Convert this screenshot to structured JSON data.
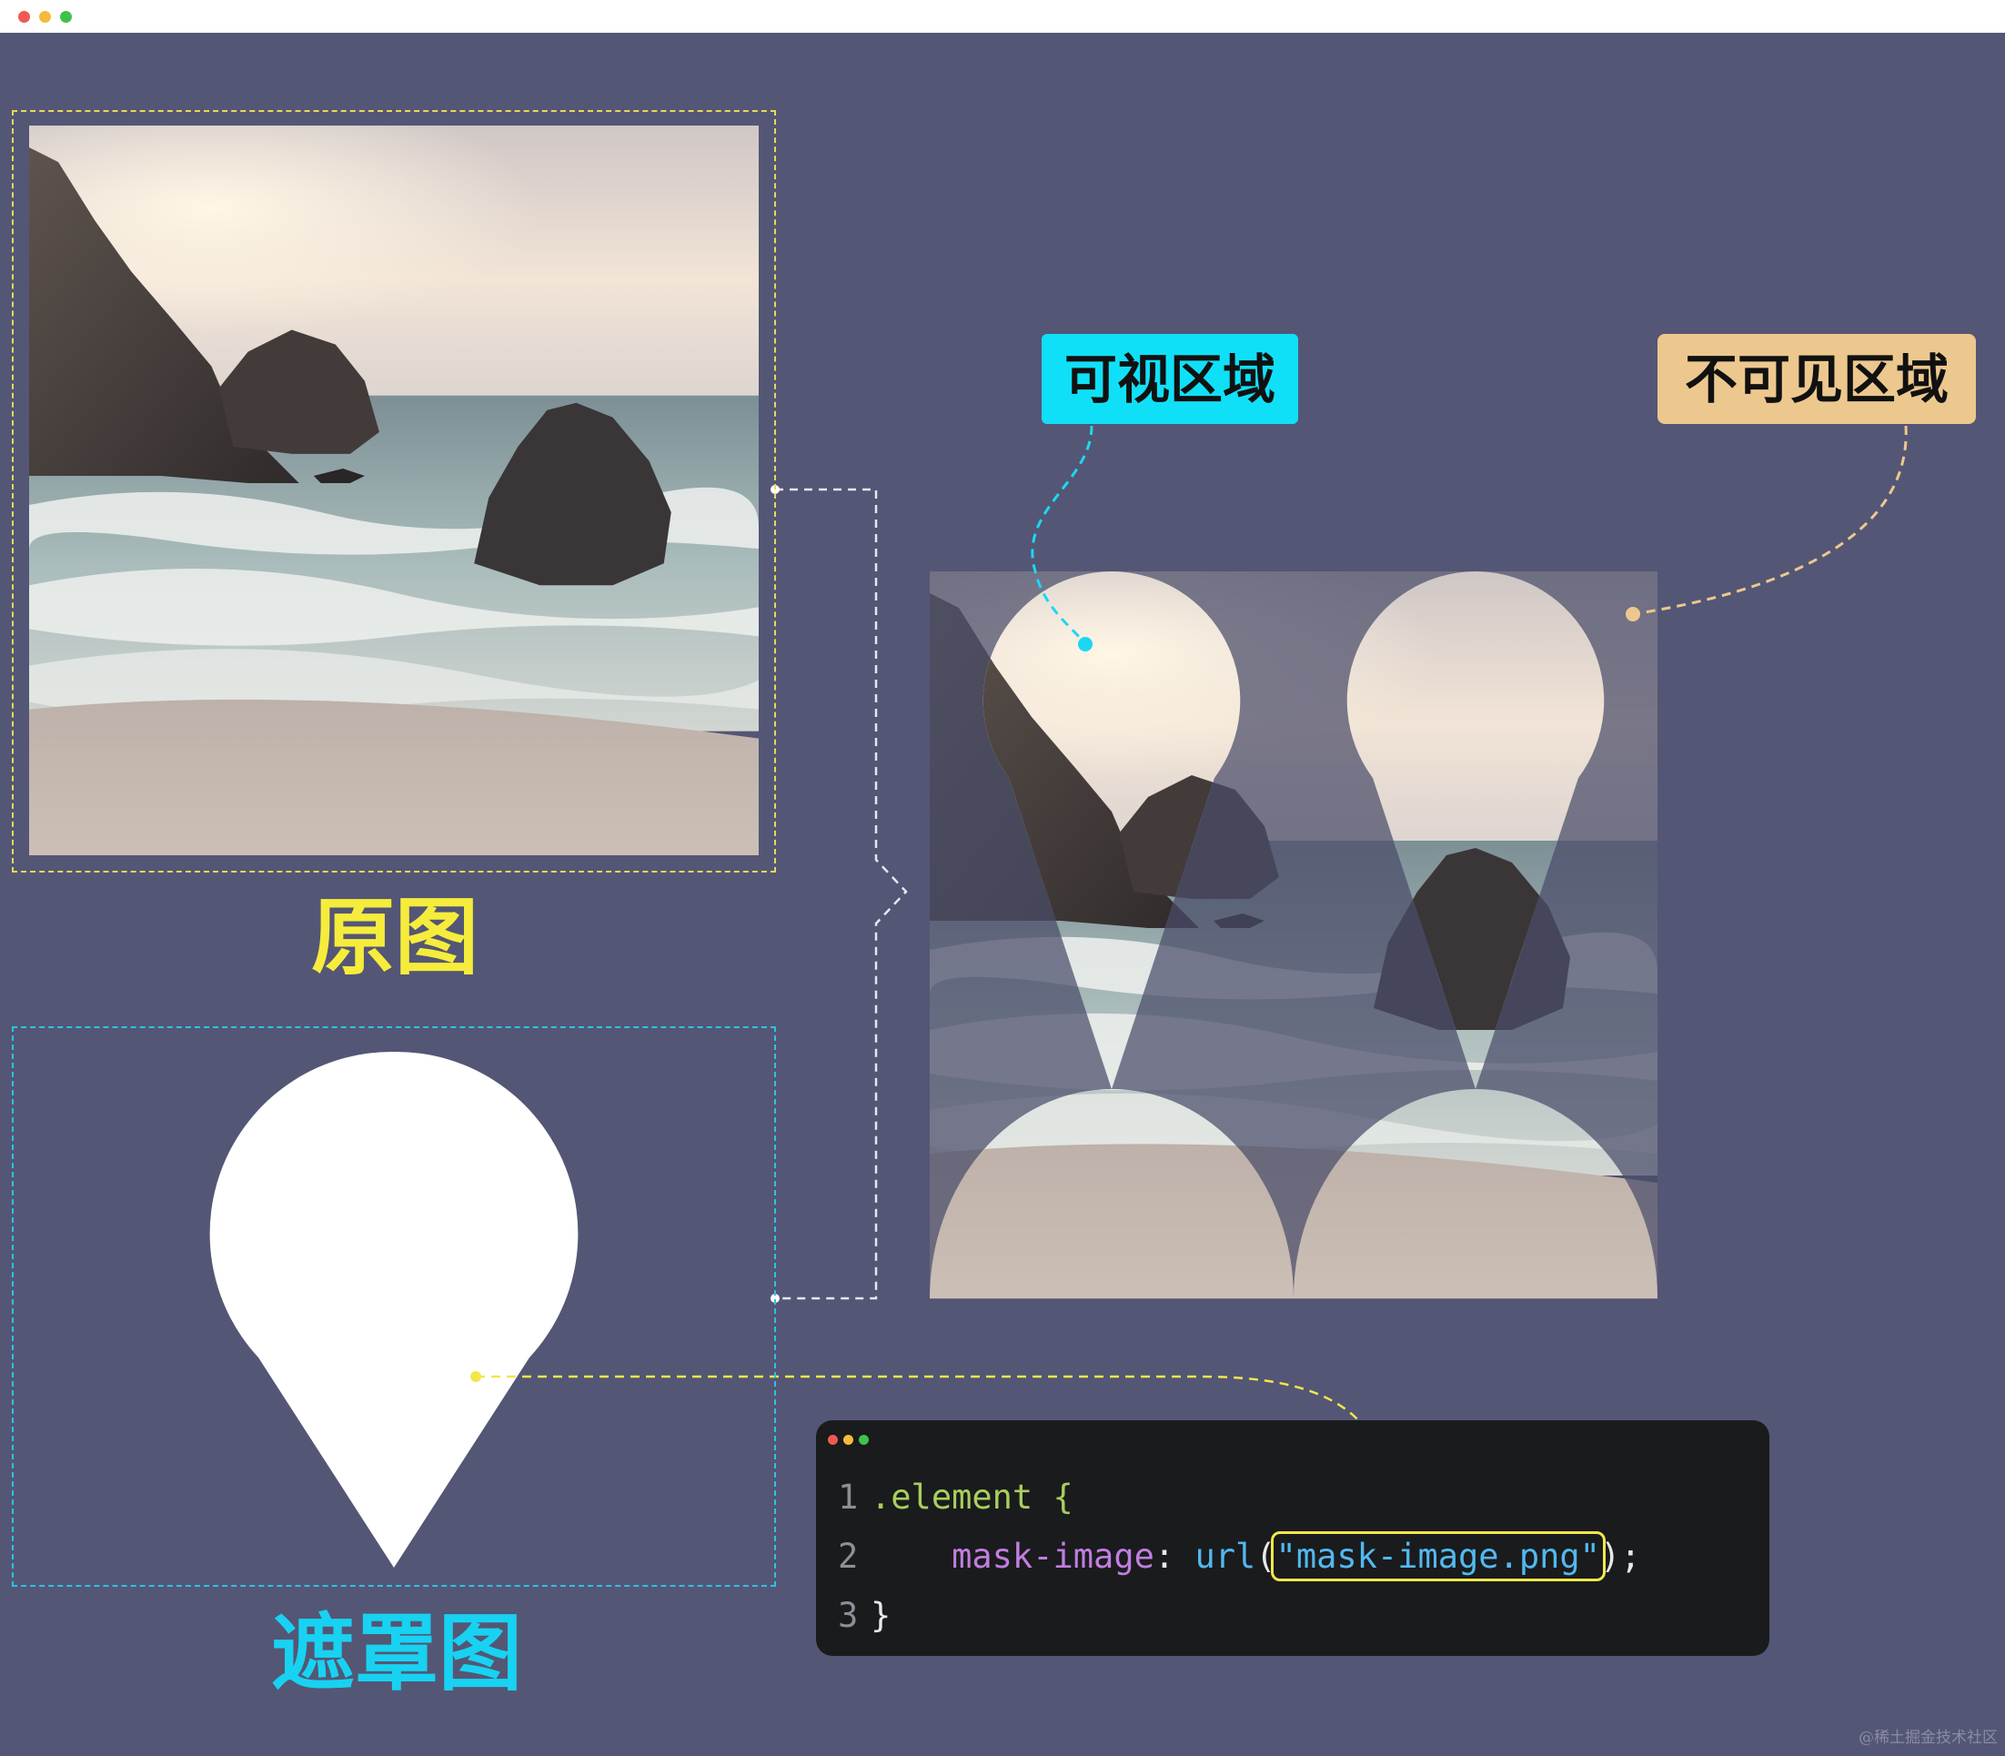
{
  "window": {
    "controls": [
      {
        "name": "close",
        "color": "#ee5a52"
      },
      {
        "name": "minimize",
        "color": "#f4bb3c"
      },
      {
        "name": "maximize",
        "color": "#3fc24b"
      }
    ]
  },
  "labels": {
    "original": "原图",
    "mask": "遮罩图",
    "visible_region": "可视区域",
    "invisible_region": "不可见区域"
  },
  "colors": {
    "background": "#545675",
    "original_accent": "#f6ec3c",
    "mask_accent": "#18d2f2",
    "visible_tag": "#10e0f7",
    "invisible_tag": "#ecc88e"
  },
  "code": {
    "lines": [
      {
        "num": "1",
        "text": ".element {"
      },
      {
        "num": "2",
        "property": "mask-image",
        "fn": "url",
        "value": "\"mask-image.png\"",
        "suffix": ");"
      },
      {
        "num": "3",
        "text": "}"
      }
    ],
    "colon": ":",
    "open_paren": "("
  },
  "watermark": "@稀土掘金技术社区"
}
